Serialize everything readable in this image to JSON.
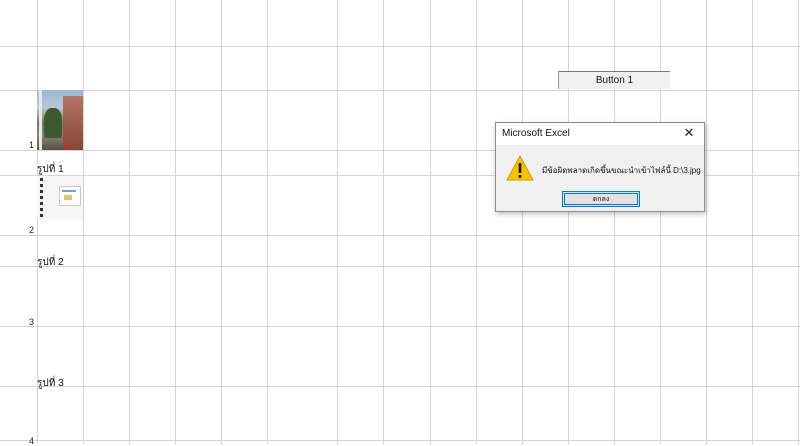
{
  "sheet": {
    "row_numbers": [
      "1",
      "2",
      "3",
      "4"
    ],
    "picture_labels": [
      "รูปที่ 1",
      "รูปที่ 2",
      "รูปที่ 3"
    ],
    "button_label": "Button 1"
  },
  "dialog": {
    "title": "Microsoft Excel",
    "message": "มีข้อผิดพลาดเกิดขึ้นขณะนำเข้าไฟล์นี้ D:\\3.jpg",
    "ok_label": "ตกลง",
    "close_glyph": "✕",
    "icon": "warning-icon",
    "accent_color": "#0078d7",
    "warning_color": "#f5c400"
  }
}
